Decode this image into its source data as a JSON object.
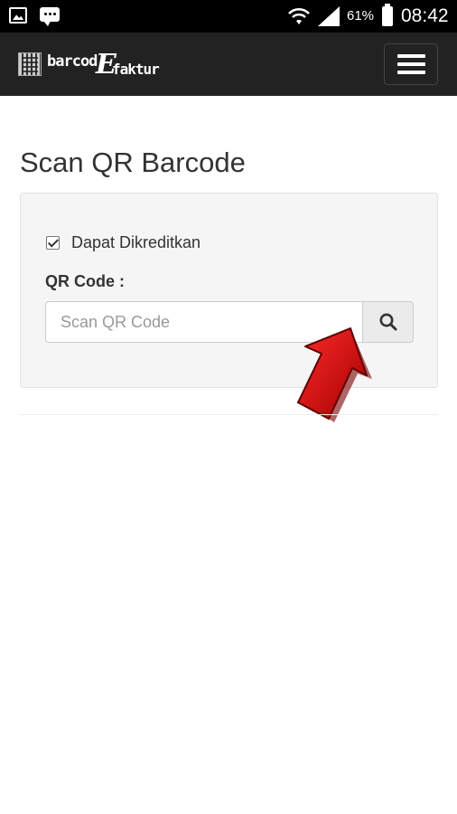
{
  "status_bar": {
    "battery_percent": "61%",
    "time": "08:42",
    "icons": [
      "gallery-icon",
      "message-icon",
      "wifi-icon",
      "signal-icon",
      "battery-icon"
    ]
  },
  "navbar": {
    "brand": {
      "part1": "barcod",
      "part2": "E",
      "part3": "faktur"
    },
    "menu_icon": "hamburger-icon"
  },
  "main": {
    "title": "Scan QR Barcode",
    "checkbox": {
      "label": "Dapat Dikreditkan",
      "checked": true
    },
    "qr_label": "QR Code :",
    "qr_input": {
      "value": "",
      "placeholder": "Scan QR Code"
    },
    "search_icon": "search-icon",
    "annotation_arrow_color": "#cc0000"
  }
}
